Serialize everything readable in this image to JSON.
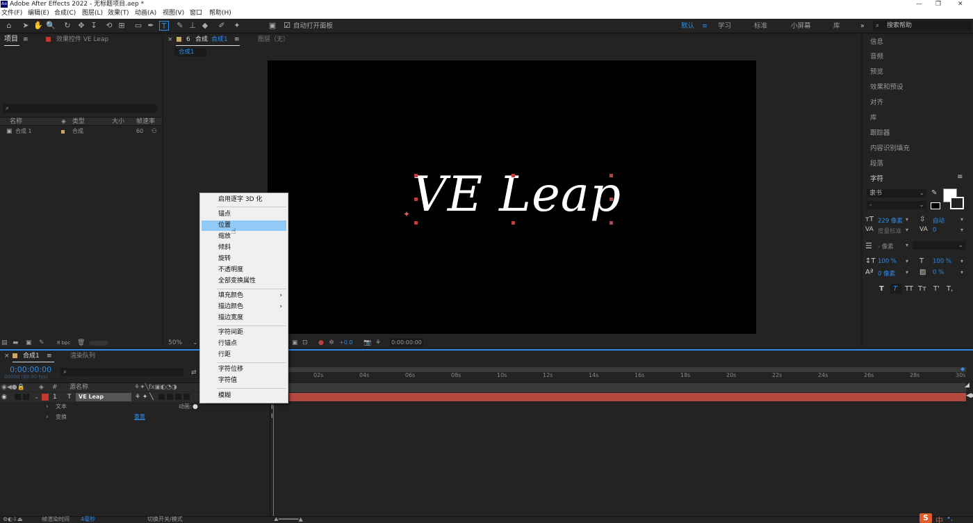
{
  "app": {
    "title": "Adobe After Effects 2022 - 无标题项目.aep *",
    "logo": "Ae",
    "window_controls": [
      "—",
      "❐",
      "✕"
    ]
  },
  "menu": [
    "文件(F)",
    "编辑(E)",
    "合成(C)",
    "图层(L)",
    "效果(T)",
    "动画(A)",
    "视图(V)",
    "窗口",
    "帮助(H)"
  ],
  "toolbar": {
    "auto_open_label": "自动打开面板",
    "workspaces": [
      "默认",
      "学习",
      "标准",
      "小屏幕",
      "库"
    ],
    "workspace_menu": "≡",
    "more": "»",
    "search_placeholder": "搜索帮助"
  },
  "project_panel": {
    "tab_project": "项目",
    "tab_effects": "效果控件 VE Leap",
    "search_icon": "⌕",
    "columns": [
      "名称",
      "类型",
      "大小",
      "帧速率"
    ],
    "rows": [
      {
        "name": "合成 1",
        "type": "合成",
        "fps": "60"
      }
    ],
    "bpc": "8 bpc"
  },
  "comp_panel": {
    "tab_label": "合成",
    "tab_name": "合成1",
    "layer_tab": "图层（无）",
    "breadcrumb": "合成1",
    "canvas_text": "VE Leap",
    "zoom": "50%",
    "exposure": "+0.0",
    "timecode": "0:00:00:00"
  },
  "context_menu": {
    "items": [
      {
        "label": "启用逐字 3D 化"
      },
      {
        "label": "锚点"
      },
      {
        "label": "位置",
        "selected": true
      },
      {
        "label": "缩放"
      },
      {
        "label": "倾斜"
      },
      {
        "label": "旋转"
      },
      {
        "label": "不透明度"
      },
      {
        "label": "全部变换属性"
      },
      {
        "label": "填充颜色",
        "submenu": true
      },
      {
        "label": "描边颜色",
        "submenu": true
      },
      {
        "label": "描边宽度"
      },
      {
        "label": "字符间距"
      },
      {
        "label": "行锚点"
      },
      {
        "label": "行距"
      },
      {
        "label": "字符位移"
      },
      {
        "label": "字符值"
      },
      {
        "label": "模糊"
      }
    ],
    "submenu_arrow": "›"
  },
  "right_panel": {
    "items": [
      "信息",
      "音频",
      "预览",
      "效果和预设",
      "对齐",
      "库",
      "跟踪器",
      "内容识别填充",
      "段落"
    ],
    "character": {
      "title": "字符",
      "menu": "≡",
      "font": "隶书",
      "style": "-",
      "size": "229 像素",
      "leading": "自动",
      "kerning": "度量标准",
      "tracking": "0",
      "stroke": "- 像素",
      "vscale": "100 %",
      "hscale": "100 %",
      "baseline": "0 像素",
      "tsume": "0 %",
      "styles": [
        "T",
        "T",
        "TT",
        "Tт",
        "T'",
        "T,"
      ]
    }
  },
  "timeline": {
    "tab_comp": "合成1",
    "tab_render": "渲染队列",
    "timecode": "0:00:00:00",
    "frames": "00000 (60.00 fps)",
    "search_icon": "⌕",
    "layer_col_num": "#",
    "layer_col_name": "源名称",
    "layer": {
      "num": "1",
      "type": "T",
      "name": "VE Leap"
    },
    "sub_text": "文本",
    "animate_label": "动画:",
    "sub_transform": "变换",
    "reset": "重置",
    "ticks": [
      "02s",
      "04s",
      "06s",
      "08s",
      "10s",
      "12s",
      "14s",
      "16s",
      "18s",
      "20s",
      "22s",
      "24s",
      "26s",
      "28s",
      "30s"
    ],
    "footer_render": "帧渲染时间",
    "footer_ms": "4毫秒",
    "footer_toggle": "切换开关/模式"
  },
  "colors": {
    "accent": "#2d8ceb",
    "layer_bar": "#b5483f",
    "menu_selected": "#91c9f7",
    "handle": "#c04040"
  },
  "taskbar": {
    "ime": "中",
    "punct": "•,"
  }
}
